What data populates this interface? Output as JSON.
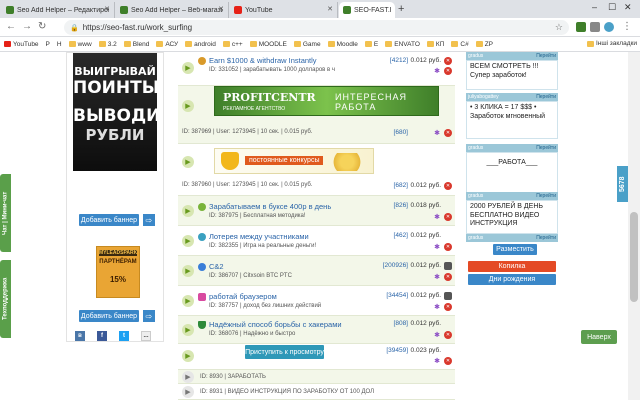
{
  "browser": {
    "tabs": [
      {
        "title": "Seo Add Helper – Редактировать",
        "active": false,
        "color": "#3f7f2a"
      },
      {
        "title": "Seo Add Helper – Веб-магазин C…",
        "active": false,
        "color": "#3f7f2a"
      },
      {
        "title": "YouTube",
        "active": false,
        "color": "#e62117"
      },
      {
        "title": "SEO-FAST.RU",
        "active": true,
        "color": "#3f7f2a"
      }
    ],
    "new_tab": "+",
    "url": "https://seo-fast.ru/work_surfing",
    "bookmarks": [
      "YouTube",
      "P",
      "H",
      "www",
      "3.2",
      "Blend",
      "АСУ",
      "android",
      "c++",
      "MOODLE",
      "Game",
      "Moodle",
      "E",
      "ENVATO",
      "КП",
      "C#",
      "ZP"
    ],
    "bookmarks_right": "Інші закладки"
  },
  "left": {
    "banner_lines": [
      "ВЫИГРЫВАЙ",
      "ПОИНТЫ",
      "ВЫВОДИ",
      "РУБЛИ"
    ],
    "add_banner_label": "Добавить баннер",
    "arrow": "⇨",
    "partner_top": "MYLEADSPARK",
    "partner_main": "ПАРТНЁРАМ",
    "partner_pct": "15%",
    "add_banner_label2": "Добавить баннер",
    "social_more": "..."
  },
  "sidetabs": {
    "chat": "Чат | Мини-чат",
    "support": "Техподдержка"
  },
  "tasks": [
    {
      "title": "Earn $1000 & withdraw Instantly",
      "desc": "ID: 331052 | зарабатывать 1000 долларов в ч",
      "count": "[4212]",
      "price": "0.012 руб."
    },
    {
      "title": "",
      "desc": "ID: 387969 | User: 1273945 | 10 сек. | 0.015 руб.",
      "count": "[680]",
      "price": ""
    },
    {
      "title": "",
      "desc": "ID: 387960 | User: 1273945 | 10 сек. | 0.015 руб.",
      "count": "[682]",
      "price": "0.012 руб."
    },
    {
      "title": "Зарабатываем в буксе 400р в день",
      "desc": "ID: 387975 | Бесплатная методика!",
      "count": "[826]",
      "price": "0.018 руб."
    },
    {
      "title": "Лотерея между участниками",
      "desc": "ID: 382355 | Игра на реальные деньги!",
      "count": "[462]",
      "price": "0.012 руб."
    },
    {
      "title": "C&2",
      "desc": "ID: 386707 | Citxsoin BTC PTC",
      "count": "[200926]",
      "price": "0.012 руб."
    },
    {
      "title": "работай браузером",
      "desc": "ID: 387757 | доход без лишних действий",
      "count": "[34454]",
      "price": "0.012 руб."
    },
    {
      "title": "Надёжный способ борьбы с хакерами",
      "desc": "ID: 368076 | Надёжно и быстро",
      "count": "[808]",
      "price": "0.012 руб."
    },
    {
      "title": "",
      "desc": "",
      "count": "[39459]",
      "price": "0.023 руб."
    },
    {
      "title": "",
      "desc": "ID: 8930 | ЗАРАБОТАТЬ",
      "count": "",
      "price": ""
    },
    {
      "title": "",
      "desc": "ID: 8931 | ВИДЕО ИНСТРУКЦИЯ ПО ЗАРАБОТКУ ОТ 100 ДОЛ",
      "count": "",
      "price": ""
    }
  ],
  "banner1": {
    "left": "PROFITCENTR",
    "left_sub": "РЕКЛАМНОЕ АГЕНТСТВО",
    "right": "ИНТЕРЕСНАЯ РАБОТА"
  },
  "banner2": {
    "label": "постоянные конкурсы"
  },
  "start_button": "Приступить к просмотру",
  "right": {
    "blocks": [
      {
        "user": "gradus",
        "go": "Перейти",
        "text": "ВСЕМ СМОТРЕТЬ !!! Супер заработок!"
      },
      {
        "user": "juliyabogattey",
        "go": "Перейти",
        "text": "• 3 КЛИКА = 17 $$$ • Заработок мгновенный"
      },
      {
        "user": "gradus",
        "go": "Перейти",
        "text": "___РАБОТА___"
      },
      {
        "user": "gradus",
        "go": "Перейти",
        "text": "2000 РУБЛЕЙ В ДЕНЬ БЕСПЛАТНО ВИДЕО ИНСТРУКЦИЯ"
      },
      {
        "user": "gradus",
        "go": "Перейти",
        "text": ""
      }
    ],
    "place_button": "Разместить",
    "piggy_button": "Копилка",
    "birthday_button": "Дни рождения"
  },
  "counter": "5678",
  "up_button": "Наверх",
  "colors": {
    "accent_green": "#5d9e4f",
    "link_blue": "#2a64a8",
    "button_blue": "#3a87c8",
    "danger_red": "#d9382c"
  }
}
